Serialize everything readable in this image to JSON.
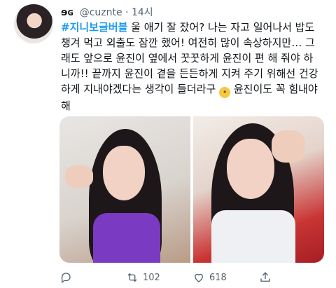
{
  "tweet": {
    "display_name": "ɘɢ",
    "handle": "@cuznte",
    "time": "· 14시",
    "hashtag": "#지니보글버블",
    "text": " 울 애기 잘 잤어? 나는 자고 일어나서 밥도 챙겨 먹고 외출도 잠깐 했어! 여전히 많이 속상하지만… 그래도 앞으로 윤진이 옆에서 꿋꿋하게 윤진이 편 해 줘야 하니까!! 끝까지 윤진이 곁을 든든하게 지켜 주기 위해선 건강하게 지내야겠다는 생각이 들더라구 ",
    "emoji": "😢",
    "text_end": " 윤진이도 꼭 힘내야 해"
  },
  "actions": {
    "reply_count": "",
    "retweet_count": "102",
    "like_count": "618"
  },
  "icons": [
    "avatar",
    "reply-icon",
    "retweet-icon",
    "like-icon",
    "share-icon"
  ],
  "colors": {
    "accent": "#1d9bf0",
    "secondary_text": "#536471"
  }
}
